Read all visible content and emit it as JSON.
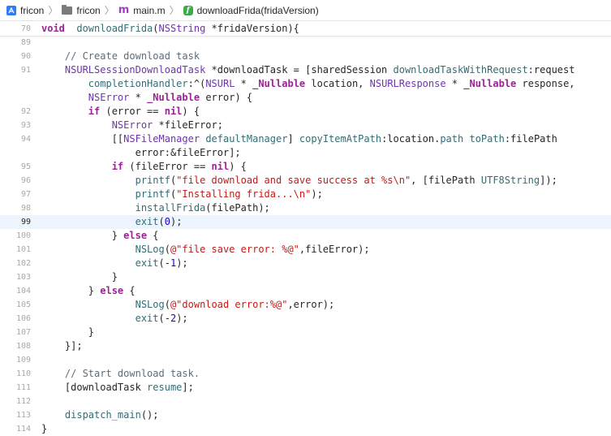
{
  "breadcrumb": {
    "project": "fricon",
    "folder": "fricon",
    "file": "main.m",
    "symbol": "downloadFrida(fridaVersion)"
  },
  "icons": [
    "xcode-project-icon",
    "folder-icon",
    "objc-file-icon",
    "function-icon"
  ],
  "colors": {
    "keyword": "#9b2393",
    "string": "#c41a16",
    "number": "#1c00cf",
    "comment": "#5d6c79",
    "function": "#326d74",
    "type": "#0b4f79",
    "current_line_bg": "#ecf5fe"
  },
  "editor": {
    "current_line": "99",
    "lines": [
      {
        "n": "70",
        "tokens": [
          [
            "kw",
            "void"
          ],
          [
            "",
            "  "
          ],
          [
            "fn",
            "downloadFrida"
          ],
          [
            "",
            "("
          ],
          [
            "ty2",
            "NSString"
          ],
          [
            "",
            " *fridaVersion){"
          ]
        ]
      },
      {
        "n": "89",
        "tokens": []
      },
      {
        "n": "90",
        "tokens": [
          [
            "",
            "    "
          ],
          [
            "cm",
            "// Create download task"
          ]
        ]
      },
      {
        "n": "91",
        "tokens": [
          [
            "",
            "    "
          ],
          [
            "ty2",
            "NSURLSessionDownloadTask"
          ],
          [
            "",
            " *downloadTask = ["
          ],
          [
            "",
            "sharedSession "
          ],
          [
            "fn",
            "downloadTaskWithRequest"
          ],
          [
            "",
            ":request"
          ]
        ]
      },
      {
        "n": "",
        "tokens": [
          [
            "",
            "        "
          ],
          [
            "fn",
            "completionHandler"
          ],
          [
            "",
            ":^("
          ],
          [
            "ty2",
            "NSURL"
          ],
          [
            "",
            " * "
          ],
          [
            "null",
            "_Nullable"
          ],
          [
            "",
            " location, "
          ],
          [
            "ty2",
            "NSURLResponse"
          ],
          [
            "",
            " * "
          ],
          [
            "null",
            "_Nullable"
          ],
          [
            "",
            " response,"
          ]
        ]
      },
      {
        "n": "",
        "tokens": [
          [
            "",
            "        "
          ],
          [
            "ty2",
            "NSError"
          ],
          [
            "",
            " * "
          ],
          [
            "null",
            "_Nullable"
          ],
          [
            "",
            " error) {"
          ]
        ]
      },
      {
        "n": "92",
        "tokens": [
          [
            "",
            "        "
          ],
          [
            "kw",
            "if"
          ],
          [
            "",
            " (error == "
          ],
          [
            "kw",
            "nil"
          ],
          [
            "",
            ") {"
          ]
        ]
      },
      {
        "n": "93",
        "tokens": [
          [
            "",
            "            "
          ],
          [
            "ty2",
            "NSError"
          ],
          [
            "",
            " *fileError;"
          ]
        ]
      },
      {
        "n": "94",
        "tokens": [
          [
            "",
            "            [["
          ],
          [
            "ty2",
            "NSFileManager"
          ],
          [
            "",
            " "
          ],
          [
            "fn",
            "defaultManager"
          ],
          [
            "",
            "] "
          ],
          [
            "fn",
            "copyItemAtPath"
          ],
          [
            "",
            ":location."
          ],
          [
            "fn",
            "path"
          ],
          [
            "",
            " "
          ],
          [
            "fn",
            "toPath"
          ],
          [
            "",
            ":filePath"
          ]
        ]
      },
      {
        "n": "",
        "tokens": [
          [
            "",
            "                error:&fileError];"
          ]
        ]
      },
      {
        "n": "95",
        "tokens": [
          [
            "",
            "            "
          ],
          [
            "kw",
            "if"
          ],
          [
            "",
            " (fileError == "
          ],
          [
            "kw",
            "nil"
          ],
          [
            "",
            ") {"
          ]
        ]
      },
      {
        "n": "96",
        "tokens": [
          [
            "",
            "                "
          ],
          [
            "fn",
            "printf"
          ],
          [
            "",
            "("
          ],
          [
            "str",
            "\"file download and save success at %s\\n\""
          ],
          [
            "",
            ", [filePath "
          ],
          [
            "fn",
            "UTF8String"
          ],
          [
            "",
            "]);"
          ]
        ]
      },
      {
        "n": "97",
        "tokens": [
          [
            "",
            "                "
          ],
          [
            "fn",
            "printf"
          ],
          [
            "",
            "("
          ],
          [
            "str",
            "\"Installing frida...\\n\""
          ],
          [
            "",
            ");"
          ]
        ]
      },
      {
        "n": "98",
        "tokens": [
          [
            "",
            "                "
          ],
          [
            "fn",
            "installFrida"
          ],
          [
            "",
            "(filePath);"
          ]
        ]
      },
      {
        "n": "99",
        "tokens": [
          [
            "",
            "                "
          ],
          [
            "fn",
            "exit"
          ],
          [
            "",
            "("
          ],
          [
            "num",
            "0"
          ],
          [
            "",
            ");"
          ]
        ]
      },
      {
        "n": "100",
        "tokens": [
          [
            "",
            "            } "
          ],
          [
            "kw",
            "else"
          ],
          [
            "",
            " {"
          ]
        ]
      },
      {
        "n": "101",
        "tokens": [
          [
            "",
            "                "
          ],
          [
            "fn",
            "NSLog"
          ],
          [
            "",
            "("
          ],
          [
            "str",
            "@\"file save error: %@\""
          ],
          [
            "",
            ",fileError);"
          ]
        ]
      },
      {
        "n": "102",
        "tokens": [
          [
            "",
            "                "
          ],
          [
            "fn",
            "exit"
          ],
          [
            "",
            "(-"
          ],
          [
            "num",
            "1"
          ],
          [
            "",
            ");"
          ]
        ]
      },
      {
        "n": "103",
        "tokens": [
          [
            "",
            "            }"
          ]
        ]
      },
      {
        "n": "104",
        "tokens": [
          [
            "",
            "        } "
          ],
          [
            "kw",
            "else"
          ],
          [
            "",
            " {"
          ]
        ]
      },
      {
        "n": "105",
        "tokens": [
          [
            "",
            "                "
          ],
          [
            "fn",
            "NSLog"
          ],
          [
            "",
            "("
          ],
          [
            "str",
            "@\"download error:%@\""
          ],
          [
            "",
            ",error);"
          ]
        ]
      },
      {
        "n": "106",
        "tokens": [
          [
            "",
            "                "
          ],
          [
            "fn",
            "exit"
          ],
          [
            "",
            "(-"
          ],
          [
            "num",
            "2"
          ],
          [
            "",
            ");"
          ]
        ]
      },
      {
        "n": "107",
        "tokens": [
          [
            "",
            "        }"
          ]
        ]
      },
      {
        "n": "108",
        "tokens": [
          [
            "",
            "    }];"
          ]
        ]
      },
      {
        "n": "109",
        "tokens": []
      },
      {
        "n": "110",
        "tokens": [
          [
            "",
            "    "
          ],
          [
            "cm",
            "// Start download task."
          ]
        ]
      },
      {
        "n": "111",
        "tokens": [
          [
            "",
            "    [downloadTask "
          ],
          [
            "fn",
            "resume"
          ],
          [
            "",
            "];"
          ]
        ]
      },
      {
        "n": "112",
        "tokens": []
      },
      {
        "n": "113",
        "tokens": [
          [
            "",
            "    "
          ],
          [
            "fn",
            "dispatch_main"
          ],
          [
            "",
            "();"
          ]
        ]
      },
      {
        "n": "114",
        "tokens": [
          [
            "",
            "}"
          ]
        ]
      }
    ]
  }
}
